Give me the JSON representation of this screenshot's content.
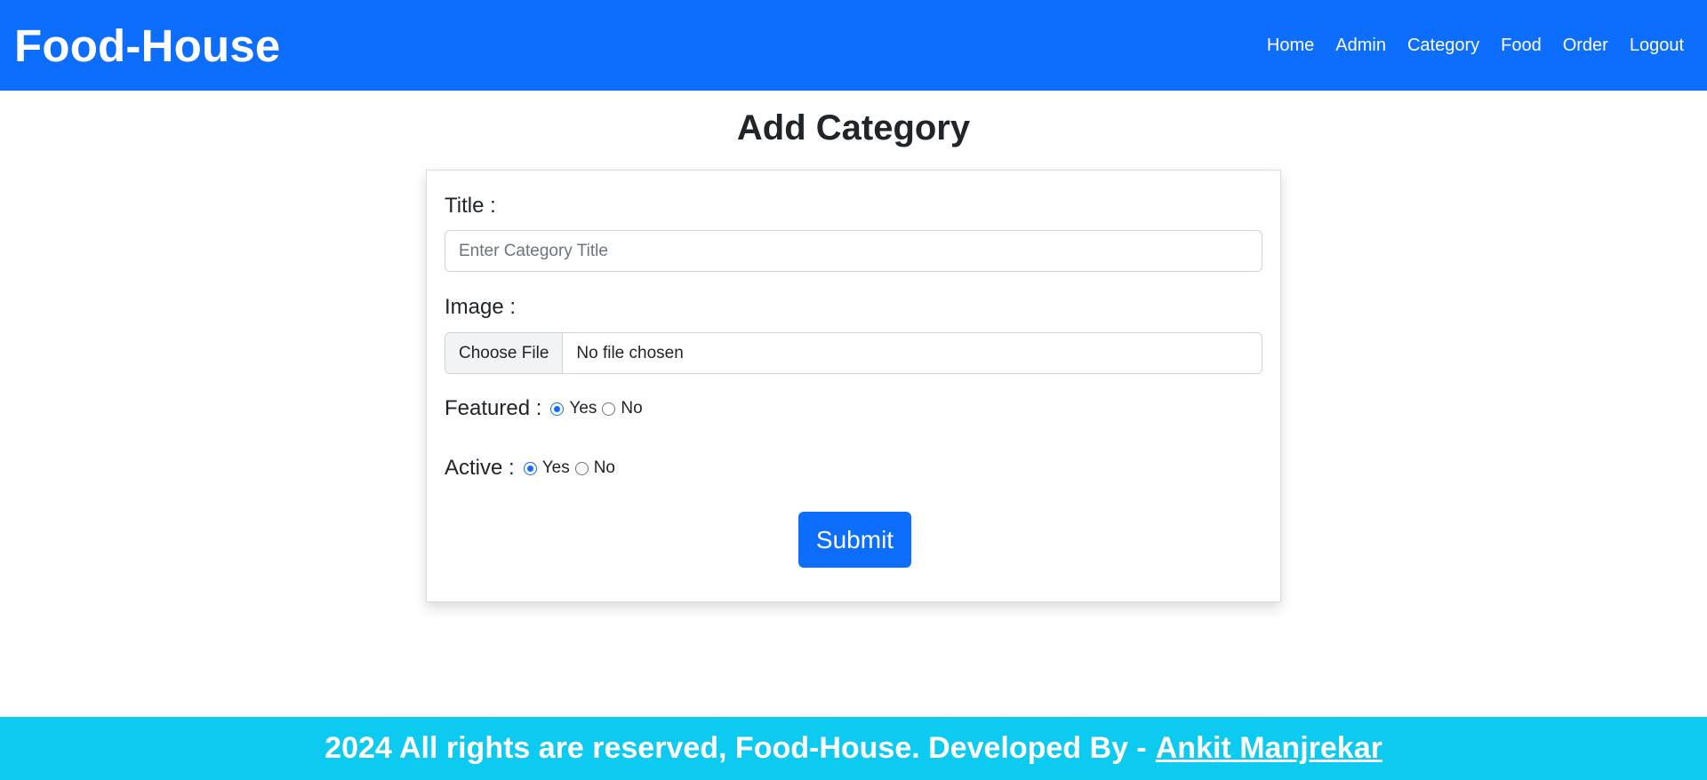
{
  "navbar": {
    "brand": "Food-House",
    "links": [
      "Home",
      "Admin",
      "Category",
      "Food",
      "Order",
      "Logout"
    ]
  },
  "page": {
    "title": "Add Category"
  },
  "form": {
    "title_label": "Title :",
    "title_placeholder": "Enter Category Title",
    "title_value": "",
    "image_label": "Image :",
    "file_button": "Choose File",
    "file_status": "No file chosen",
    "featured_label": "Featured :",
    "featured_options": [
      "Yes",
      "No"
    ],
    "featured_selected": "Yes",
    "active_label": "Active :",
    "active_options": [
      "Yes",
      "No"
    ],
    "active_selected": "Yes",
    "submit_label": "Submit"
  },
  "footer": {
    "text": "2024 All rights are reserved, Food-House. Developed By -",
    "author_link": "Ankit Manjrekar"
  },
  "colors": {
    "primary": "#0d6efd",
    "footer_bg": "#0dcaf0"
  }
}
